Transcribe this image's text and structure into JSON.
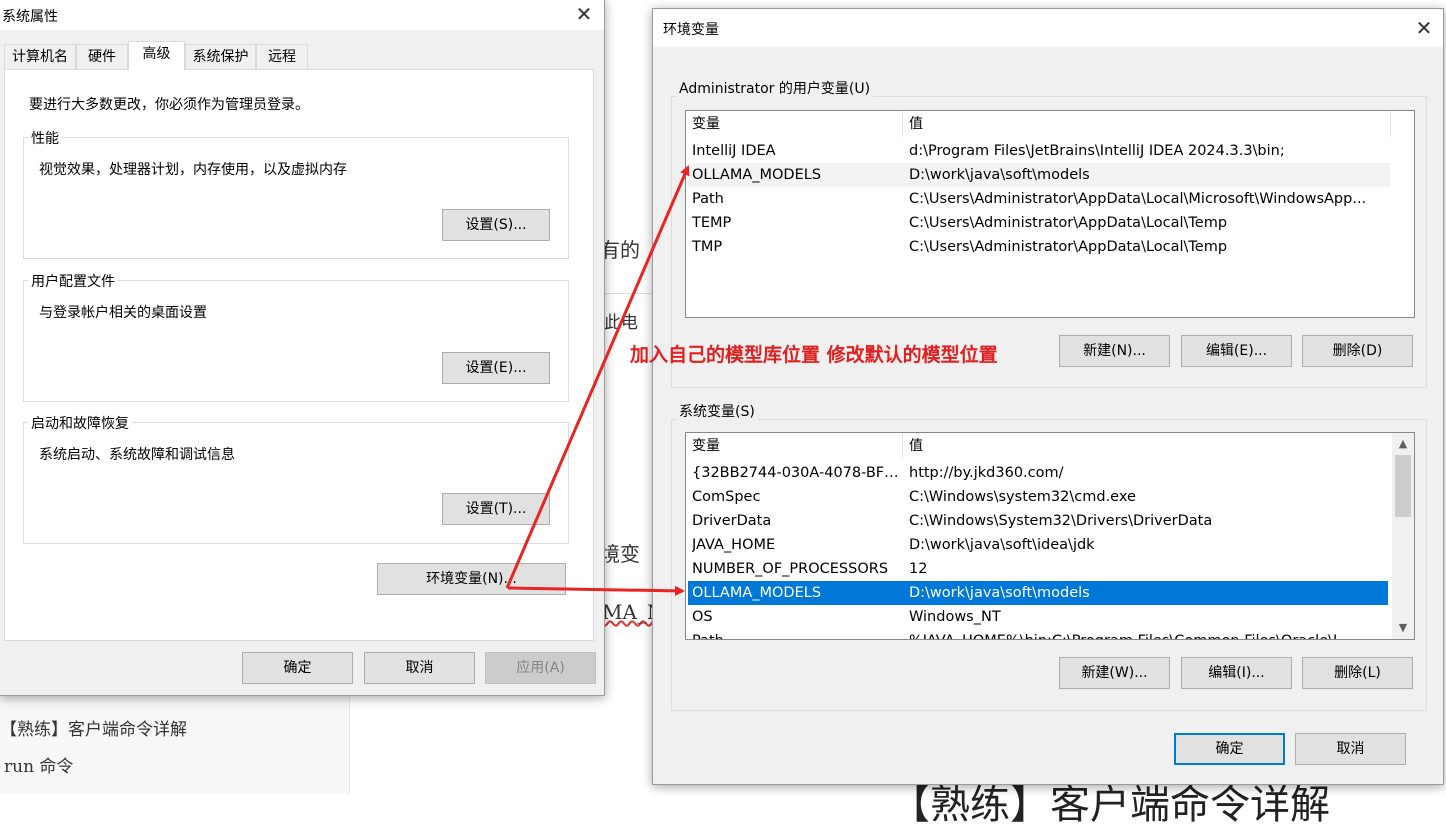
{
  "background": {
    "fragment_1": "有的",
    "fragment_2": "此电",
    "fragment_3": "境变",
    "fragment_4": "MA_M",
    "left_line_1": "【熟练】客户端命令详解",
    "left_line_2": "run 命令",
    "bottom_big": "【熟练】客户端命令详解"
  },
  "sys_props": {
    "title": "系统属性",
    "tabs": [
      "计算机名",
      "硬件",
      "高级",
      "系统保护",
      "远程"
    ],
    "active_tab": "高级",
    "admin_note": "要进行大多数更改，你必须作为管理员登录。",
    "groups": [
      {
        "label": "性能",
        "desc": "视觉效果，处理器计划，内存使用，以及虚拟内存",
        "button": "设置(S)..."
      },
      {
        "label": "用户配置文件",
        "desc": "与登录帐户相关的桌面设置",
        "button": "设置(E)..."
      },
      {
        "label": "启动和故障恢复",
        "desc": "系统启动、系统故障和调试信息",
        "button": "设置(T)..."
      }
    ],
    "env_button": "环境变量(N)...",
    "ok": "确定",
    "cancel": "取消",
    "apply": "应用(A)"
  },
  "env_vars": {
    "title": "环境变量",
    "user_group_label": "Administrator 的用户变量(U)",
    "columns": [
      "变量",
      "值"
    ],
    "user_vars": [
      {
        "name": "IntelliJ IDEA",
        "value": "d:\\Program Files\\JetBrains\\IntelliJ IDEA 2024.3.3\\bin;"
      },
      {
        "name": "OLLAMA_MODELS",
        "value": "D:\\work\\java\\soft\\models"
      },
      {
        "name": "Path",
        "value": "C:\\Users\\Administrator\\AppData\\Local\\Microsoft\\WindowsApp..."
      },
      {
        "name": "TEMP",
        "value": "C:\\Users\\Administrator\\AppData\\Local\\Temp"
      },
      {
        "name": "TMP",
        "value": "C:\\Users\\Administrator\\AppData\\Local\\Temp"
      }
    ],
    "user_buttons": {
      "new": "新建(N)...",
      "edit": "编辑(E)...",
      "delete": "删除(D)"
    },
    "system_group_label": "系统变量(S)",
    "system_vars": [
      {
        "name": "{32BB2744-030A-4078-BFC...",
        "value": "http://by.jkd360.com/"
      },
      {
        "name": "ComSpec",
        "value": "C:\\Windows\\system32\\cmd.exe"
      },
      {
        "name": "DriverData",
        "value": "C:\\Windows\\System32\\Drivers\\DriverData"
      },
      {
        "name": "JAVA_HOME",
        "value": "D:\\work\\java\\soft\\idea\\jdk"
      },
      {
        "name": "NUMBER_OF_PROCESSORS",
        "value": "12"
      },
      {
        "name": "OLLAMA_MODELS",
        "value": "D:\\work\\java\\soft\\models"
      },
      {
        "name": "OS",
        "value": "Windows_NT"
      },
      {
        "name": "Path",
        "value": "%JAVA_HOME%\\bin;C:\\Program Files\\Common Files\\Oracle\\J..."
      }
    ],
    "selected_system_var": "OLLAMA_MODELS",
    "system_buttons": {
      "new": "新建(W)...",
      "edit": "编辑(I)...",
      "delete": "删除(L)"
    },
    "ok": "确定",
    "cancel": "取消"
  },
  "annotation": {
    "text": "加入自己的模型库位置 修改默认的模型位置",
    "color": "#e02020"
  }
}
